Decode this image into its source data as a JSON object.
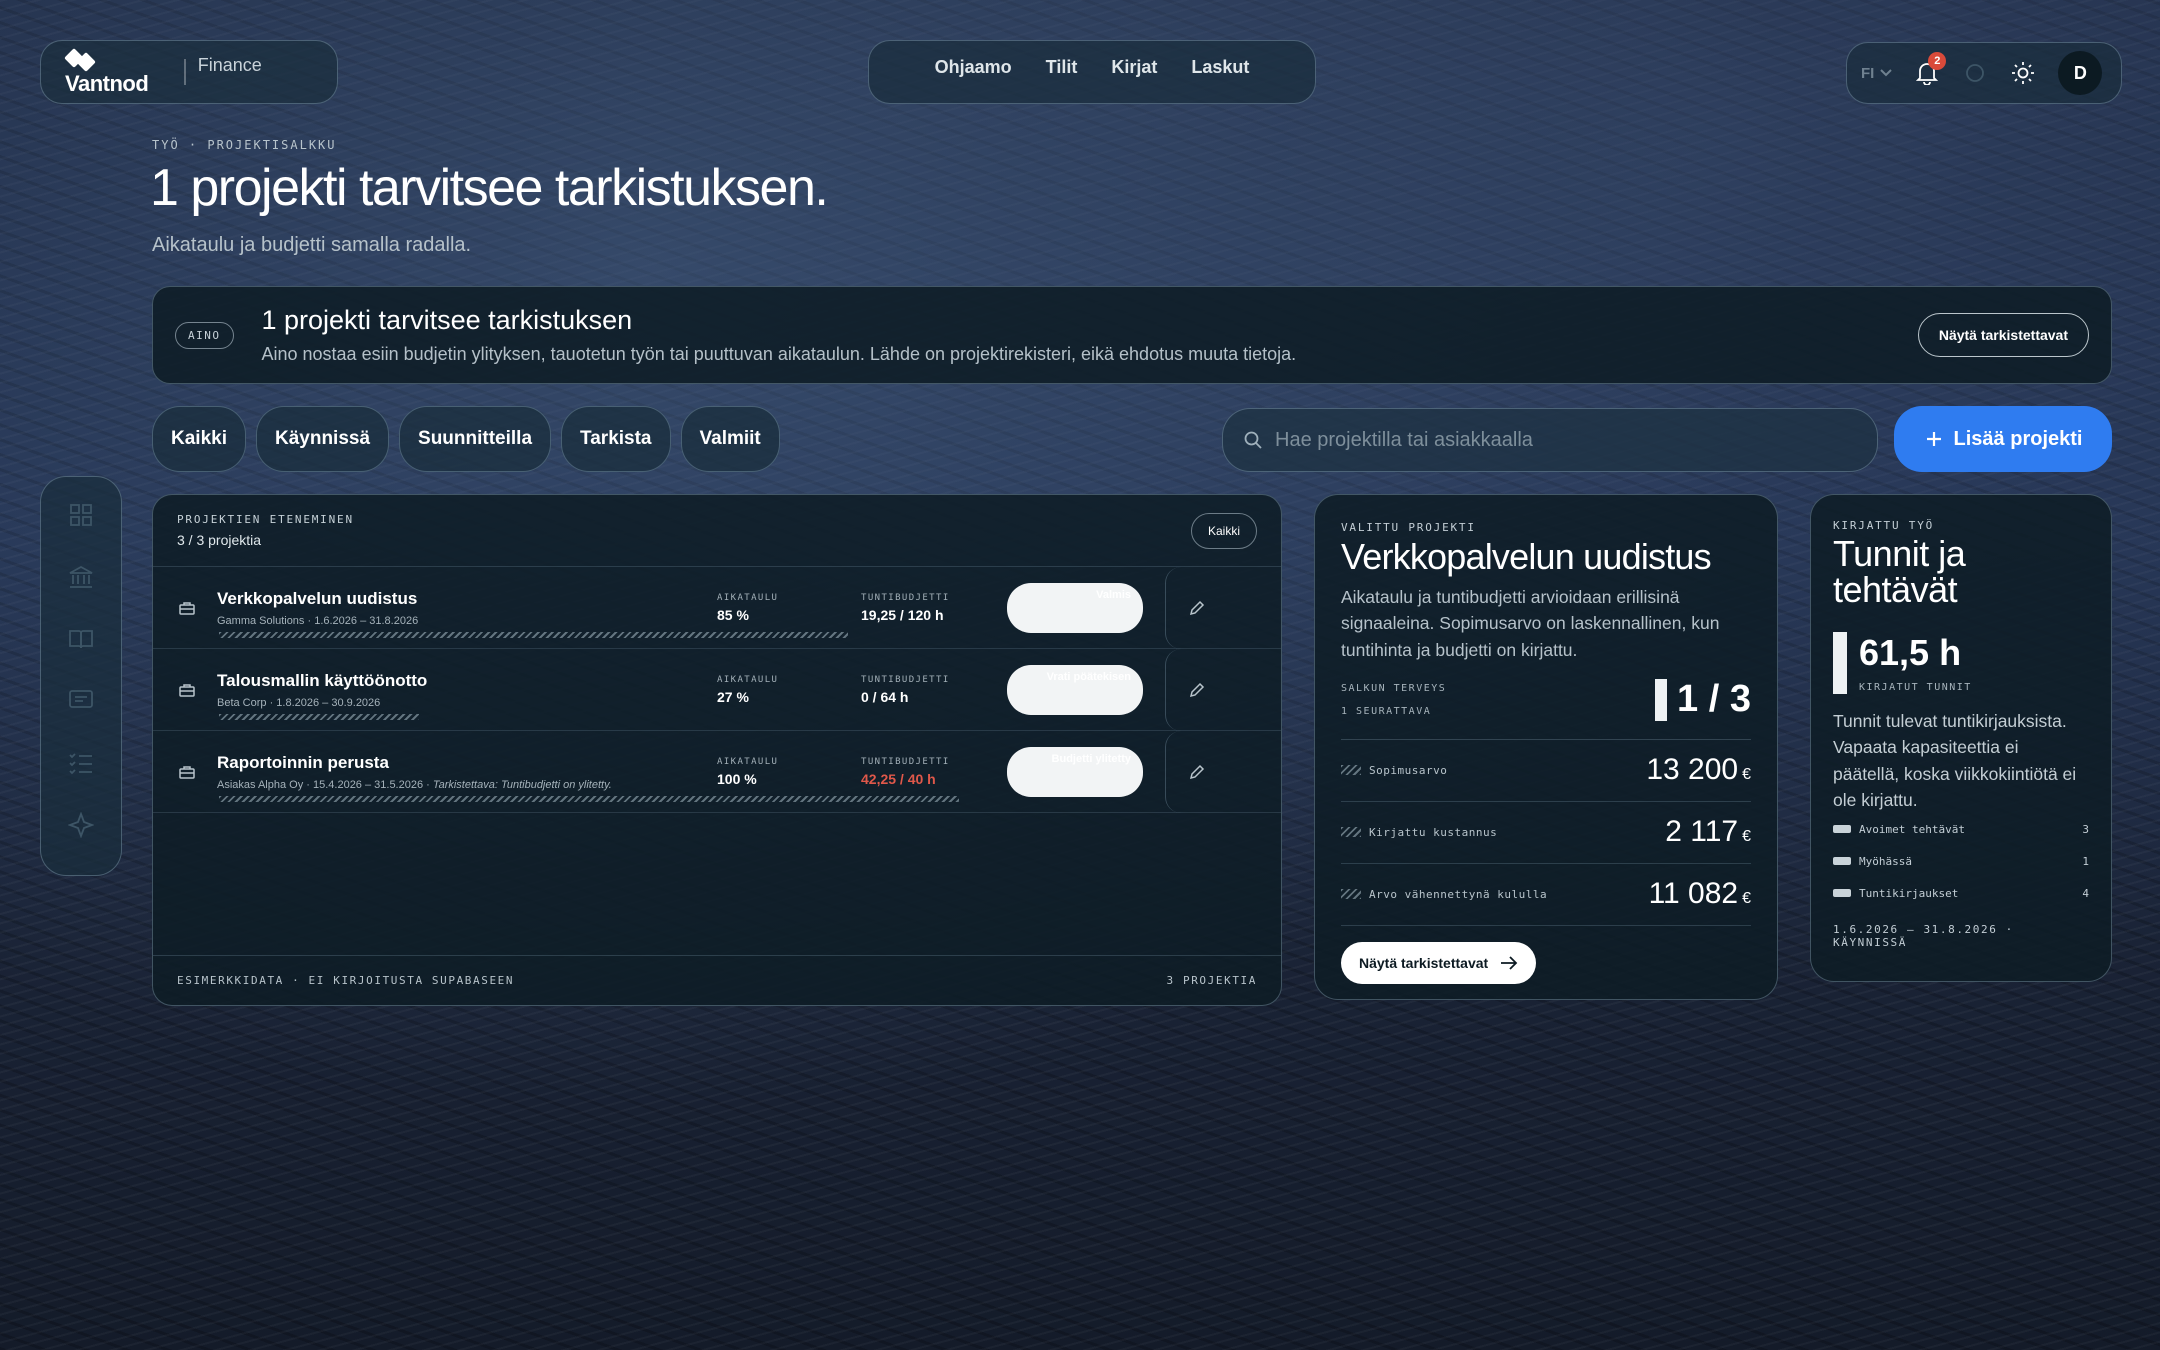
{
  "brand": {
    "name": "Vantnod",
    "module": "Finance"
  },
  "nav": {
    "items": [
      "Ohjaamo",
      "Tilit",
      "Kirjat",
      "Laskut"
    ]
  },
  "toolbar": {
    "language": "FI",
    "notifications": "2",
    "avatar": "D"
  },
  "header": {
    "breadcrumb": "TYÖ · PROJEKTISALKKU",
    "title": "1 projekti tarvitsee tarkistuksen.",
    "subtitle": "Aikataulu ja budjetti samalla radalla."
  },
  "banner": {
    "tag": "AINO",
    "title": "1 projekti tarvitsee tarkistuksen",
    "text": "Aino nostaa esiin budjetin ylityksen, tauotetun työn tai puuttuvan aikataulun. Lähde on projektirekisteri, eikä ehdotus muuta tietoja.",
    "button": "Näytä tarkistettavat"
  },
  "filters": [
    "Kaikki",
    "Käynnissä",
    "Suunnitteilla",
    "Tarkista",
    "Valmiit"
  ],
  "search": {
    "placeholder": "Hae projektilla tai asiakkaalla"
  },
  "add_button": "Lisää projekti",
  "projects": {
    "label": "PROJEKTIEN ETENEMINEN",
    "count": "3 / 3 projektia",
    "filter_button": "Kaikki",
    "schedule_label": "AIKATAULU",
    "budget_label": "TUNTIBUDJETTI",
    "rows": [
      {
        "name": "Verkkopalvelun uudistus",
        "meta": "Gamma Solutions · 1.6.2026 – 31.8.2026",
        "note": "",
        "schedule": "85 %",
        "budget": "19,25 / 120 h",
        "over_budget": false,
        "status": "Valmis",
        "progress": 0.85
      },
      {
        "name": "Talousmallin käyttöönotto",
        "meta": "Beta Corp · 1.8.2026 – 30.9.2026",
        "note": "",
        "schedule": "27 %",
        "budget": "0 / 64 h",
        "over_budget": false,
        "status": "Vrati pöätekisen",
        "progress": 0.27
      },
      {
        "name": "Raportoinnin perusta",
        "meta": "Asiakas Alpha Oy · 15.4.2026 – 31.5.2026 · ",
        "note": "Tarkistettava: Tuntibudjetti on ylitetty.",
        "schedule": "100 %",
        "budget": "42,25 / 40 h",
        "over_budget": true,
        "status": "Budjetti ylitetty",
        "progress": 1.0
      }
    ],
    "footer_left": "ESIMERKKIDATA · EI KIRJOITUSTA SUPABASEEN",
    "footer_right": "3 PROJEKTIA"
  },
  "selected": {
    "label": "VALITTU PROJEKTI",
    "title": "Verkkopalvelun uudistus",
    "description": "Aikataulu ja tuntibudjetti arvioidaan erillisinä signaaleina. Sopimusarvo on laskennallinen, kun tuntihinta ja budjetti on kirjattu.",
    "health_label": "SALKUN TERVEYS",
    "health_sub": "1 SEURATTAVA",
    "health_value": "1 / 3",
    "metrics": [
      {
        "label": "Sopimusarvo",
        "value": "13 200",
        "unit": "€"
      },
      {
        "label": "Kirjattu kustannus",
        "value": "2 117",
        "unit": "€"
      },
      {
        "label": "Arvo vähennettynä kululla",
        "value": "11 082",
        "unit": "€"
      }
    ],
    "button": "Näytä tarkistettavat"
  },
  "hours": {
    "label": "KIRJATTU TYÖ",
    "title": "Tunnit ja tehtävät",
    "total": "61,5 h",
    "total_label": "KIRJATUT TUNNIT",
    "description": "Tunnit tulevat tuntikirjauksista. Vapaata kapasiteettia ei päätellä, koska viikkokiintiötä ei ole kirjattu.",
    "legend": [
      {
        "label": "Avoimet tehtävät",
        "value": "3"
      },
      {
        "label": "Myöhässä",
        "value": "1"
      },
      {
        "label": "Tuntikirjaukset",
        "value": "4"
      }
    ],
    "dates": "1.6.2026 – 31.8.2026 · KÄYNNISSÄ"
  }
}
